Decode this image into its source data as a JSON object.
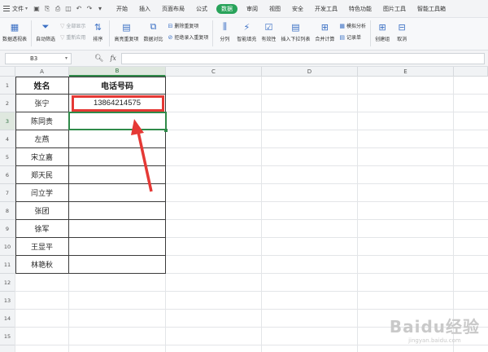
{
  "menubar": {
    "file_label": "文件",
    "tabs": [
      "开始",
      "插入",
      "页面布局",
      "公式",
      "数据",
      "审阅",
      "视图",
      "安全",
      "开发工具",
      "特色功能",
      "图片工具",
      "智能工具箱"
    ],
    "active_tab_index": 4
  },
  "ribbon": {
    "pivot": "数据透视表",
    "autofilter": "自动筛选",
    "show_all": "全部显示",
    "reapply": "重新应用",
    "sort": "排序",
    "highlight_dup": "高亮重复项",
    "data_compare": "数据对比",
    "remove_dup": "删除重复项",
    "reject_dup": "拒绝录入重复项",
    "split": "分列",
    "smart_fill": "智能填充",
    "validation": "有效性",
    "dropdown": "插入下拉列表",
    "consolidate": "合并计算",
    "simulate": "模拟分析",
    "record": "记录单",
    "create_group": "创建组",
    "cancel": "取消"
  },
  "formulabar": {
    "cell_ref": "B3",
    "fx": "fx"
  },
  "grid": {
    "columns": [
      "A",
      "B",
      "C",
      "D",
      "E"
    ],
    "rows": [
      "1",
      "2",
      "3",
      "4",
      "5",
      "6",
      "7",
      "8",
      "9",
      "10",
      "11",
      "12",
      "13",
      "14",
      "15",
      "16"
    ],
    "selected_column": "B",
    "selected_row": "3"
  },
  "table": {
    "header_name": "姓名",
    "header_phone": "电话号码",
    "names": [
      "张宁",
      "陈同贵",
      "左燕",
      "宋立嘉",
      "郑天民",
      "闫立学",
      "张团",
      "徐军",
      "王显平",
      "林艳秋"
    ],
    "phones": [
      "13864214575",
      "",
      "",
      "",
      "",
      "",
      "",
      "",
      "",
      ""
    ]
  },
  "watermark": {
    "line1": "Baidu经验",
    "line2": "jingyan.baidu.com"
  },
  "colors": {
    "accent_green": "#28a35a",
    "highlight_red": "#e53935"
  }
}
